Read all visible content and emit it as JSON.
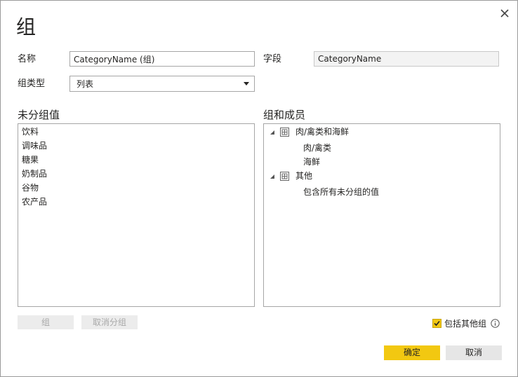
{
  "dialog": {
    "title": "组",
    "close_icon": "close-icon"
  },
  "form": {
    "name_label": "名称",
    "name_value": "CategoryName (组)",
    "field_label": "字段",
    "field_value": "CategoryName",
    "group_type_label": "组类型",
    "group_type_value": "列表"
  },
  "ungrouped": {
    "title": "未分组值",
    "items": [
      {
        "label": "饮料"
      },
      {
        "label": "调味品"
      },
      {
        "label": "糖果"
      },
      {
        "label": "奶制品"
      },
      {
        "label": "谷物"
      },
      {
        "label": "农产品"
      }
    ]
  },
  "groups": {
    "title": "组和成员",
    "tree": [
      {
        "label": "肉/禽类和海鲜",
        "expanded": true,
        "members": [
          "肉/禽类",
          "海鲜"
        ]
      },
      {
        "label": "其他",
        "expanded": true,
        "members": [
          "包含所有未分组的值"
        ]
      }
    ]
  },
  "actions": {
    "group_label": "组",
    "ungroup_label": "取消分组",
    "include_other_label": "包括其他组",
    "include_other_checked": true,
    "ok_label": "确定",
    "cancel_label": "取消"
  },
  "colors": {
    "accent": "#f2c811",
    "checkbox_check": "#252423",
    "border": "#a6a6a6"
  }
}
